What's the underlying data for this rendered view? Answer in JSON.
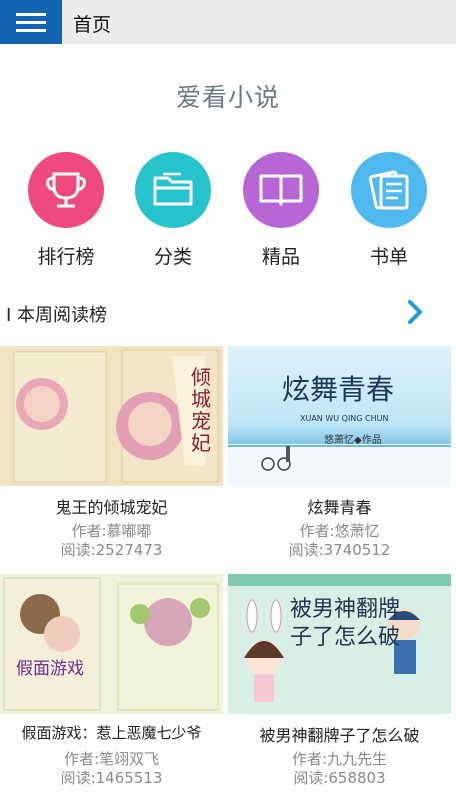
{
  "header": {
    "title": "首页"
  },
  "app": {
    "name": "爱看小说"
  },
  "categories": [
    {
      "label": "排行榜",
      "icon": "trophy-icon",
      "color": "#ee4a7f"
    },
    {
      "label": "分类",
      "icon": "folder-icon",
      "color": "#27c3cc"
    },
    {
      "label": "精品",
      "icon": "book-icon",
      "color": "#b866d6"
    },
    {
      "label": "书单",
      "icon": "list-icon",
      "color": "#4fb8ee"
    }
  ],
  "section": {
    "title": "I 本周阅读榜"
  },
  "books": [
    {
      "title": "鬼王的倾城宠妃",
      "author": "作者:慕嘟嘟",
      "reads": "阅读:2527473",
      "cover_text": "倾城宠妃"
    },
    {
      "title": "炫舞青春",
      "author": "作者:悠萧忆",
      "reads": "阅读:3740512",
      "cover_text": "炫舞青春",
      "cover_sub": "XUAN WU QING CHUN",
      "cover_credit": "悠萧忆◆作品"
    },
    {
      "title": "假面游戏：惹上恶魔七少爷",
      "author": "作者:笔翊双飞",
      "reads": "阅读:1465513",
      "cover_text": "假面游戏"
    },
    {
      "title": "被男神翻牌子了怎么破",
      "author": "作者:九九先生",
      "reads": "阅读:658803",
      "cover_text": "被男神翻牌子了怎么破"
    }
  ]
}
